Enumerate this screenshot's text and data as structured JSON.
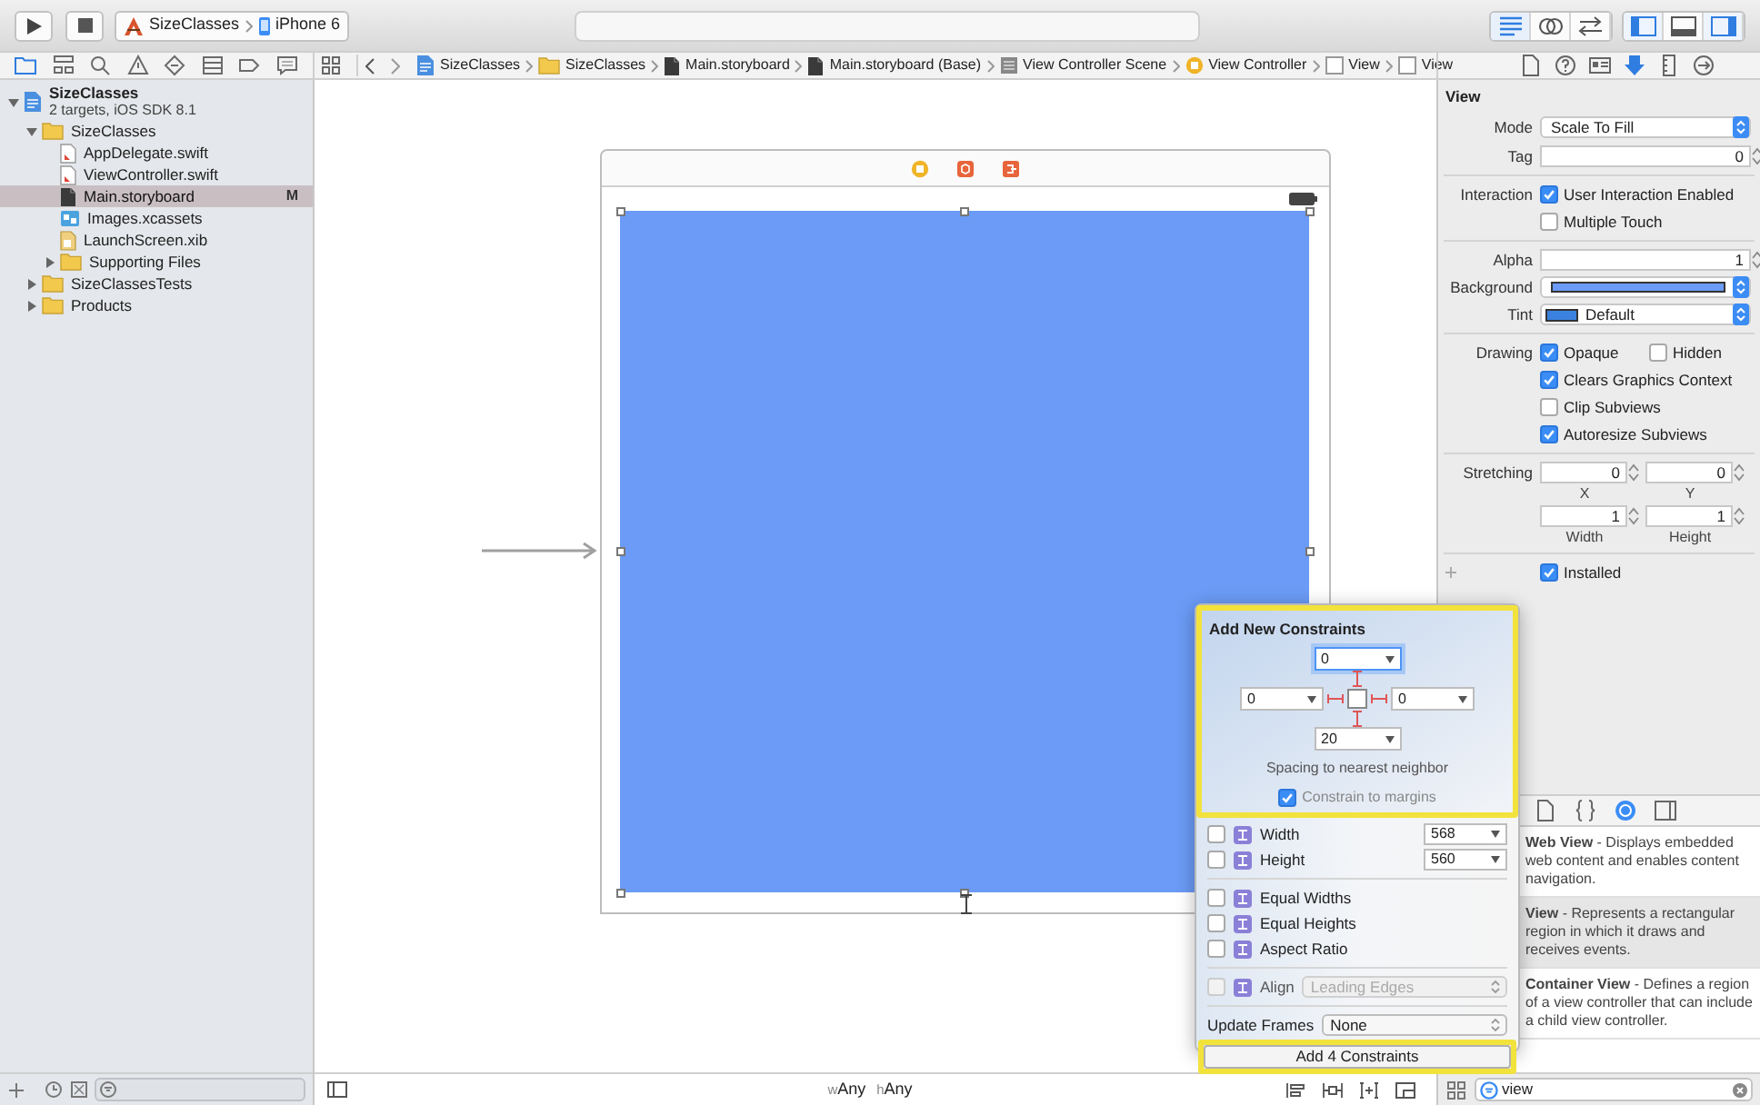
{
  "toolbar": {
    "scheme": "SizeClasses",
    "device": "iPhone 6",
    "editor_modes": [
      {
        "selected": true
      },
      {
        "selected": false
      },
      {
        "selected": false
      }
    ],
    "panels": [
      {
        "on": true
      },
      {
        "on": false
      },
      {
        "on": true
      }
    ]
  },
  "navigator_tabs": [
    {
      "selected": true
    },
    {
      "selected": false
    },
    {
      "selected": false
    },
    {
      "selected": false
    },
    {
      "selected": false
    },
    {
      "selected": false
    },
    {
      "selected": false
    },
    {
      "selected": false
    }
  ],
  "jump_bar": [
    {
      "label": "SizeClasses",
      "kind": "project"
    },
    {
      "label": "SizeClasses",
      "kind": "folder"
    },
    {
      "label": "Main.storyboard",
      "kind": "storyboard"
    },
    {
      "label": "Main.storyboard (Base)",
      "kind": "storyboard"
    },
    {
      "label": "View Controller Scene",
      "kind": "scene"
    },
    {
      "label": "View Controller",
      "kind": "controller"
    },
    {
      "label": "View",
      "kind": "view"
    },
    {
      "label": "View",
      "kind": "view"
    }
  ],
  "inspector_tabs": [
    {
      "selected": false
    },
    {
      "selected": false
    },
    {
      "selected": false
    },
    {
      "selected": true
    },
    {
      "selected": false
    },
    {
      "selected": false
    }
  ],
  "navigator": {
    "tree": [
      {
        "label": "SizeClasses",
        "subtitle": "2 targets, iOS SDK 8.1",
        "kind": "project",
        "expanded": true,
        "selected": false,
        "children": [
          {
            "label": "SizeClasses",
            "kind": "folder",
            "expanded": true,
            "selected": false,
            "children": [
              {
                "label": "AppDelegate.swift",
                "kind": "swift",
                "selected": false
              },
              {
                "label": "ViewController.swift",
                "kind": "swift",
                "selected": false
              },
              {
                "label": "Main.storyboard",
                "kind": "storyboard",
                "selected": true,
                "badge": "M"
              },
              {
                "label": "Images.xcassets",
                "kind": "assets",
                "selected": false
              },
              {
                "label": "LaunchScreen.xib",
                "kind": "xib",
                "selected": false
              },
              {
                "label": "Supporting Files",
                "kind": "folder",
                "expanded": false,
                "selected": false
              }
            ]
          },
          {
            "label": "SizeClassesTests",
            "kind": "folder",
            "expanded": false,
            "selected": false
          },
          {
            "label": "Products",
            "kind": "folder",
            "expanded": false,
            "selected": false
          }
        ]
      }
    ]
  },
  "canvas": {
    "size_classes": [
      {
        "prefix": "w",
        "value": "Any"
      },
      {
        "prefix": "h",
        "value": "Any"
      }
    ]
  },
  "inspector": {
    "title": "View",
    "mode": {
      "label": "Mode",
      "value": "Scale To Fill"
    },
    "tag": {
      "label": "Tag",
      "value": "0"
    },
    "interaction": {
      "label": "Interaction",
      "options": [
        {
          "label": "User Interaction Enabled",
          "checked": true
        },
        {
          "label": "Multiple Touch",
          "checked": false
        }
      ]
    },
    "alpha": {
      "label": "Alpha",
      "value": "1"
    },
    "background": {
      "label": "Background"
    },
    "tint": {
      "label": "Tint",
      "value": "Default"
    },
    "drawing": {
      "label": "Drawing",
      "options": [
        {
          "label": "Opaque",
          "checked": true
        },
        {
          "label": "Hidden",
          "checked": false
        },
        {
          "label": "Clears Graphics Context",
          "checked": true
        },
        {
          "label": "Clip Subviews",
          "checked": false
        },
        {
          "label": "Autoresize Subviews",
          "checked": true
        }
      ]
    },
    "stretching": {
      "label": "Stretching",
      "fields": [
        {
          "value": "0",
          "caption": "X"
        },
        {
          "value": "0",
          "caption": "Y"
        },
        {
          "value": "1",
          "caption": "Width"
        },
        {
          "value": "1",
          "caption": "Height"
        }
      ]
    },
    "installed": {
      "label": "Installed",
      "checked": true
    }
  },
  "library_tabs": [
    {
      "selected": false
    },
    {
      "selected": false
    },
    {
      "selected": true
    },
    {
      "selected": false
    }
  ],
  "library": [
    {
      "text": "**Web View** - Displays embedded web content and enables content navigation.",
      "selected": false
    },
    {
      "text": "**View** - Represents a rectangular region in which it draws and receives events.",
      "selected": true
    },
    {
      "text": "**Container View** - Defines a region of a view controller that can include a child view controller.",
      "selected": false
    }
  ],
  "library_filter": {
    "value": "view"
  },
  "constraints_popover": {
    "title": "Add New Constraints",
    "spacing": [
      {
        "kind": "top",
        "value": "0",
        "focused": true
      },
      {
        "kind": "left",
        "value": "0",
        "focused": false
      },
      {
        "kind": "right",
        "value": "0",
        "focused": false
      },
      {
        "kind": "bottom",
        "value": "20",
        "focused": false
      }
    ],
    "spacing_caption": "Spacing to nearest neighbor",
    "margins": {
      "label": "Constrain to margins",
      "checked": true
    },
    "size": [
      {
        "label": "Width",
        "checked": false,
        "value": "568"
      },
      {
        "label": "Height",
        "checked": false,
        "value": "560"
      }
    ],
    "equal": [
      {
        "label": "Equal Widths",
        "checked": false
      },
      {
        "label": "Equal Heights",
        "checked": false
      },
      {
        "label": "Aspect Ratio",
        "checked": false
      }
    ],
    "align": {
      "label": "Align",
      "checked": false,
      "value": "Leading Edges",
      "disabled": true
    },
    "update_frames": {
      "label": "Update Frames",
      "value": "None"
    },
    "add_button": "Add 4 Constraints"
  }
}
